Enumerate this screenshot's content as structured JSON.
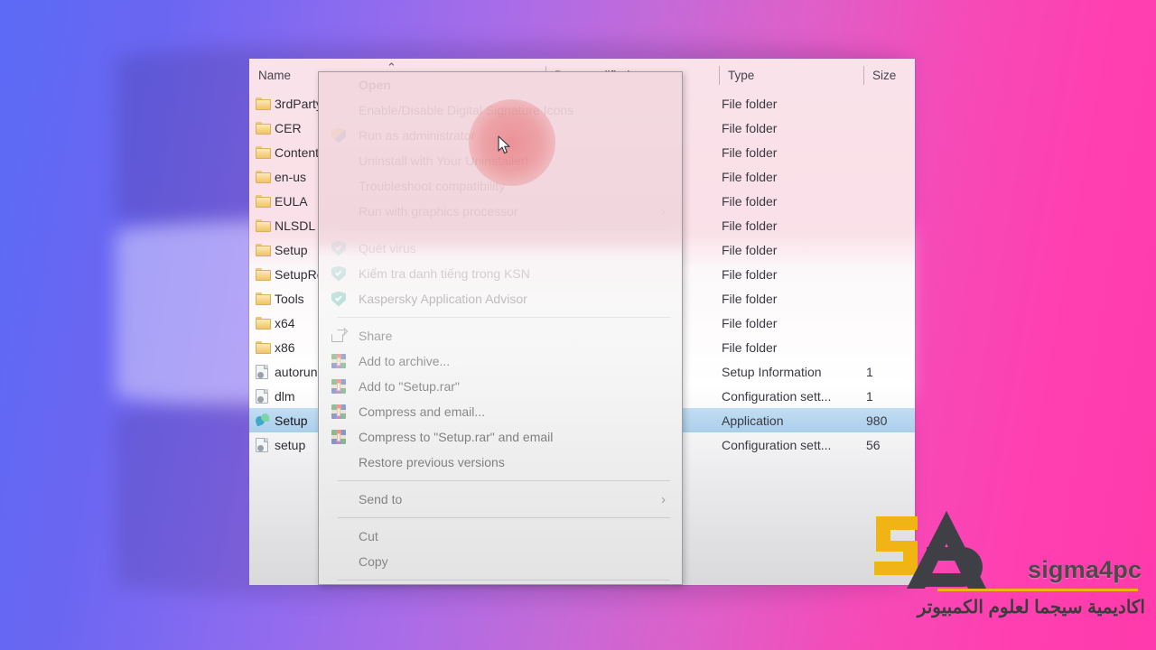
{
  "explorer": {
    "columns": [
      {
        "label": "Name",
        "sort_indicator": "⌃"
      },
      {
        "label": "Date modified"
      },
      {
        "label": "Type"
      },
      {
        "label": "Size"
      }
    ],
    "rows": [
      {
        "icon": "folder-icon",
        "name": "3rdParty",
        "date": "",
        "type": "File folder",
        "size": ""
      },
      {
        "icon": "folder-icon",
        "name": "CER",
        "date": "",
        "type": "File folder",
        "size": ""
      },
      {
        "icon": "folder-icon",
        "name": "Content",
        "date": "",
        "type": "File folder",
        "size": ""
      },
      {
        "icon": "folder-icon",
        "name": "en-us",
        "date": "",
        "type": "File folder",
        "size": ""
      },
      {
        "icon": "folder-icon",
        "name": "EULA",
        "date": "",
        "type": "File folder",
        "size": ""
      },
      {
        "icon": "folder-icon",
        "name": "NLSDL",
        "date": "",
        "type": "File folder",
        "size": ""
      },
      {
        "icon": "folder-icon",
        "name": "Setup",
        "date": "",
        "type": "File folder",
        "size": ""
      },
      {
        "icon": "folder-icon",
        "name": "SetupResources",
        "date": "",
        "type": "File folder",
        "size": ""
      },
      {
        "icon": "folder-icon",
        "name": "Tools",
        "date": "",
        "type": "File folder",
        "size": ""
      },
      {
        "icon": "folder-icon",
        "name": "x64",
        "date": "",
        "type": "File folder",
        "size": ""
      },
      {
        "icon": "folder-icon",
        "name": "x86",
        "date": "",
        "type": "File folder",
        "size": ""
      },
      {
        "icon": "file-icon",
        "name": "autorun",
        "date": "",
        "type": "Setup Information",
        "size": "1"
      },
      {
        "icon": "file-icon",
        "name": "dlm",
        "date": "",
        "type": "Configuration sett...",
        "size": "1"
      },
      {
        "icon": "app-icon",
        "name": "Setup",
        "date": "",
        "type": "Application",
        "size": "980",
        "selected": true
      },
      {
        "icon": "file-icon",
        "name": "setup",
        "date": "",
        "type": "Configuration sett...",
        "size": "56"
      }
    ]
  },
  "context_menu": {
    "items": [
      {
        "label": "Open",
        "icon": "",
        "bold": true
      },
      {
        "label": "Enable/Disable Digital Signature Icons",
        "icon": ""
      },
      {
        "label": "Run as administrator",
        "icon": "uac-shield-icon",
        "highlighted": true
      },
      {
        "label": "Uninstall with Your Uninstaller!",
        "icon": ""
      },
      {
        "label": "Troubleshoot compatibility",
        "icon": ""
      },
      {
        "label": "Run with graphics processor",
        "icon": "",
        "submenu": true
      },
      {
        "separator": true
      },
      {
        "label": "Quét virus",
        "icon": "kaspersky-shield-icon"
      },
      {
        "label": "Kiểm tra danh tiếng trong KSN",
        "icon": "kaspersky-shield-icon"
      },
      {
        "label": "Kaspersky Application Advisor",
        "icon": "kaspersky-shield-icon"
      },
      {
        "separator": true
      },
      {
        "label": "Share",
        "icon": "share-icon"
      },
      {
        "label": "Add to archive...",
        "icon": "winrar-icon"
      },
      {
        "label": "Add to \"Setup.rar\"",
        "icon": "winrar-icon"
      },
      {
        "label": "Compress and email...",
        "icon": "winrar-icon"
      },
      {
        "label": "Compress to \"Setup.rar\" and email",
        "icon": "winrar-icon"
      },
      {
        "label": "Restore previous versions",
        "icon": ""
      },
      {
        "separator": true
      },
      {
        "label": "Send to",
        "icon": "",
        "submenu": true
      },
      {
        "separator": true
      },
      {
        "label": "Cut",
        "icon": ""
      },
      {
        "label": "Copy",
        "icon": ""
      },
      {
        "separator": true
      }
    ],
    "submenu_arrow": "›"
  },
  "watermark": {
    "brand": "sigma4pc",
    "arabic": "اكاديمية سيجما لعلوم الكمبيوتر",
    "accent_color": "#f0b415",
    "dark_color": "#3c3c3c"
  },
  "colors": {
    "background_start": "#5b6bf5",
    "background_end": "#ff3aab",
    "selection": "#aacfeb",
    "menu_background": "#f2f2f2",
    "highlight_halo": "#e24646"
  }
}
